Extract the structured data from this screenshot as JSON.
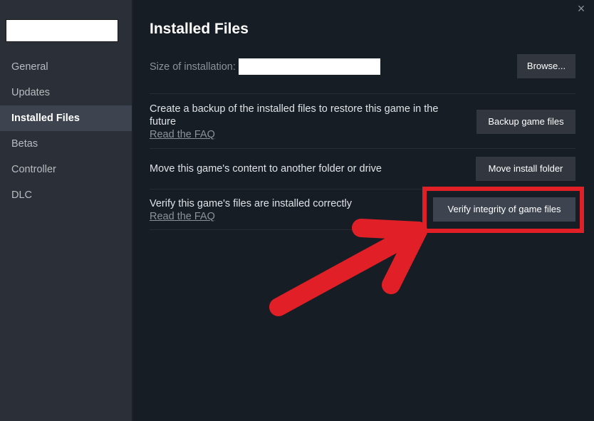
{
  "sidebar": {
    "game_title": "",
    "items": [
      {
        "label": "General",
        "active": false
      },
      {
        "label": "Updates",
        "active": false
      },
      {
        "label": "Installed Files",
        "active": true
      },
      {
        "label": "Betas",
        "active": false
      },
      {
        "label": "Controller",
        "active": false
      },
      {
        "label": "DLC",
        "active": false
      }
    ]
  },
  "header": {
    "title": "Installed Files",
    "close_icon": "×"
  },
  "size": {
    "label": "Size of installation:",
    "value": ""
  },
  "buttons": {
    "browse": "Browse...",
    "backup": "Backup game files",
    "move": "Move install folder",
    "verify": "Verify integrity of game files"
  },
  "rows": {
    "backup": {
      "text": "Create a backup of the installed files to restore this game in the future",
      "link": "Read the FAQ"
    },
    "move": {
      "text": "Move this game's content to another folder or drive"
    },
    "verify": {
      "text": "Verify this game's files are installed correctly",
      "link": "Read the FAQ"
    }
  },
  "annotation": {
    "color": "#e01f26",
    "target": "verify-integrity-button"
  }
}
